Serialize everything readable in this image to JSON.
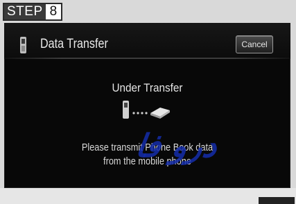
{
  "step": {
    "word": "STEP",
    "number": "8"
  },
  "header": {
    "title": "Data Transfer",
    "icon": "phone-icon",
    "cancel_label": "Cancel"
  },
  "main": {
    "status": "Under Transfer",
    "icons": [
      "phone-icon",
      "book-icon"
    ],
    "message_line1": "Please transmit Phone Book data",
    "message_line2": "from the mobile phone"
  },
  "watermark": {
    "text": "درو فا"
  },
  "colors": {
    "screen_bg": "#080808",
    "text": "#e4e4e4",
    "watermark": "#1e3aa8"
  }
}
